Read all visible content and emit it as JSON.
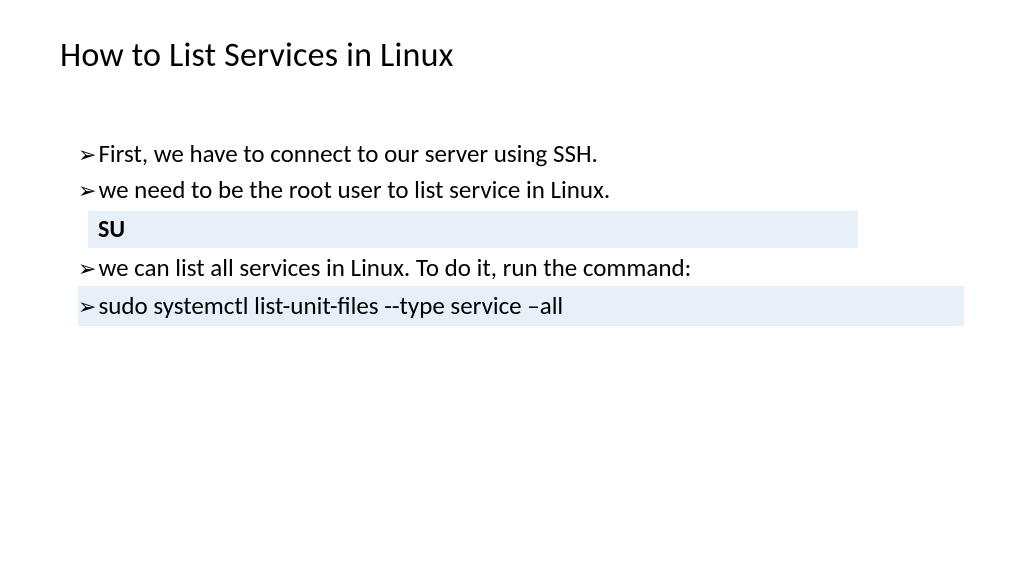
{
  "title": "How to List Services in Linux",
  "bullets": {
    "item1": "First, we have to connect to our server using SSH.",
    "item2": "we need to be the root user to list service in Linux.",
    "code1": "SU",
    "item3": "we can list all services in Linux. To do it, run the command:",
    "item4": "sudo systemctl list-unit-files --type service –all"
  }
}
